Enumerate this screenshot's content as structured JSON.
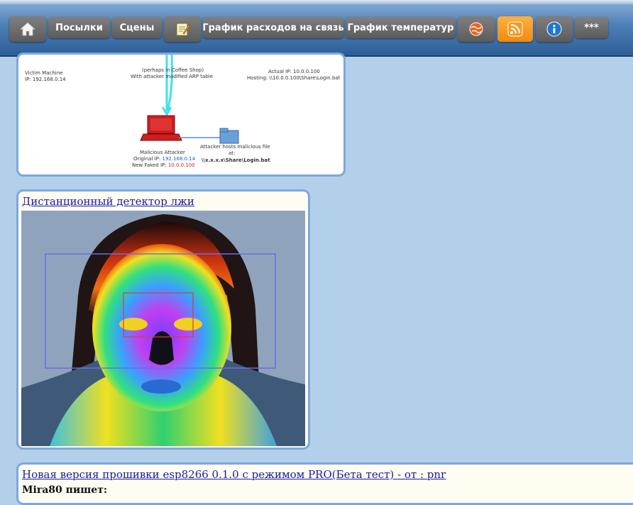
{
  "nav": {
    "home_icon": "home-icon",
    "items": [
      "Посылки",
      "Сцены",
      "График расходов на связь",
      "График температур",
      "***"
    ],
    "notes_icon": "notepad-icon",
    "globe_icon": "globe-icon",
    "rss_icon": "rss-icon",
    "info_icon": "info-icon",
    "rss_color": "#f5981e"
  },
  "diagram_card": {
    "victim_label": "Victim Machine",
    "victim_ip": "IP: 192.168.0.14",
    "cafe_label": "(perhaps in Coffee Shop)",
    "arp_label": "With attacker modified ARP table",
    "actual_ip": "Actual IP: 10.0.0.100",
    "hosting": "Hosting: \\\\10.0.0.100\\Share\\Login.bat",
    "attacker_label": "Malicious Attacker",
    "original_ip_prefix": "Original IP: ",
    "original_ip": "192.168.0.14",
    "faked_ip_prefix": "New Faked IP: ",
    "faked_ip": "10.0.0.100",
    "hosts_label": "Attacker hosts malicious file",
    "hosts_at": "at:",
    "hosts_path": "\\\\x.x.x.x\\Share\\Login.bat"
  },
  "lie_card": {
    "title": "Дистанционный детектор лжи"
  },
  "firmware_card": {
    "title": "Новая версия прошивки esp8266 0.1.0 с режимом PRO(Бета тест) - от : pnr",
    "author_line": "Mira80 пишет:"
  }
}
